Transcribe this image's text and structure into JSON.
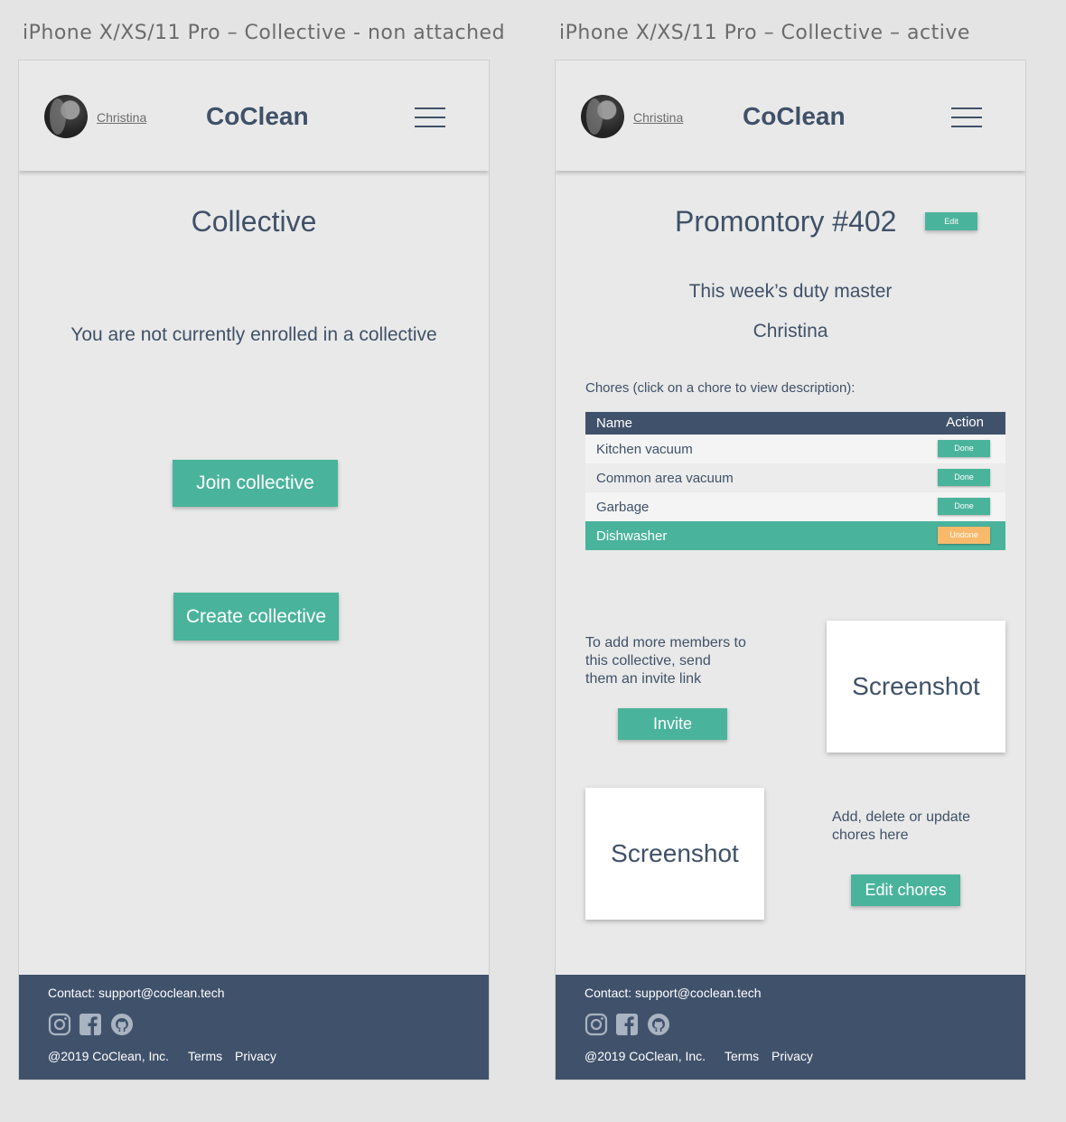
{
  "artboards": {
    "left_label": "iPhone X/XS/11 Pro – Collective - non attached",
    "right_label": "iPhone X/XS/11 Pro – Collective – active"
  },
  "header": {
    "username": "Christina",
    "brand": "CoClean",
    "menu_icon": "hamburger-menu-icon"
  },
  "non_attached": {
    "title": "Collective",
    "message": "You are not currently enrolled in a collective",
    "join_label": "Join collective",
    "create_label": "Create collective"
  },
  "active": {
    "title": "Promontory #402",
    "edit_label": "Edit",
    "duty_heading": "This week’s duty master",
    "duty_name": "Christina",
    "chores_caption": "Chores (click on a chore to view description):",
    "table": {
      "col_name": "Name",
      "col_action": "Action",
      "rows": [
        {
          "name": "Kitchen vacuum",
          "action": "Done"
        },
        {
          "name": "Common area vacuum",
          "action": "Done"
        },
        {
          "name": "Garbage",
          "action": "Done"
        },
        {
          "name": "Dishwasher",
          "action": "Undone"
        }
      ]
    },
    "invite_text_1": "To add more members to",
    "invite_text_2": "this collective, send",
    "invite_text_3": "them an invite link",
    "invite_label": "Invite",
    "screenshot_label_1": "Screenshot",
    "screenshot_label_2": "Screenshot",
    "edit_chores_text_1": "Add, delete or update",
    "edit_chores_text_2": "chores here",
    "edit_chores_label": "Edit chores"
  },
  "footer": {
    "contact": "Contact: support@coclean.tech",
    "copyright": "@2019 CoClean, Inc.",
    "terms": "Terms",
    "privacy": "Privacy",
    "icons": [
      "instagram-icon",
      "facebook-icon",
      "github-icon"
    ]
  },
  "colors": {
    "accent": "#4ab39c",
    "navy": "#40526b",
    "undone": "#f9b96b",
    "background": "#e9e9e9"
  }
}
